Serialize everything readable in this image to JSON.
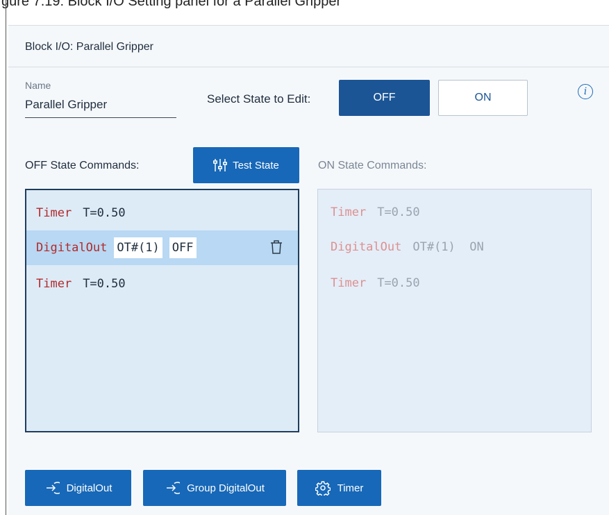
{
  "page": {
    "cutoff_title": "gure 7.19: Block I/O Setting panel for a Parallel Gripper"
  },
  "panel": {
    "title": "Block I/O: Parallel Gripper",
    "name_label": "Name",
    "name_value": "Parallel Gripper",
    "select_state_label": "Select State to Edit:",
    "state_off": "OFF",
    "state_on": "ON",
    "selected_state": "OFF",
    "info_icon": "i"
  },
  "off_state": {
    "label": "OFF State Commands:",
    "test_button": "Test State",
    "commands": [
      {
        "keyword": "Timer",
        "param": "T=0.50"
      },
      {
        "keyword": "DigitalOut",
        "output": "OT#(1)",
        "value": "OFF"
      },
      {
        "keyword": "Timer",
        "param": "T=0.50"
      }
    ]
  },
  "on_state": {
    "label": "ON State Commands:",
    "commands": [
      {
        "keyword": "Timer",
        "param": "T=0.50"
      },
      {
        "keyword": "DigitalOut",
        "param": "OT#(1)  ON"
      },
      {
        "keyword": "Timer",
        "param": "T=0.50"
      }
    ]
  },
  "add_buttons": {
    "digital_out": "DigitalOut",
    "group_digital_out": "Group DigitalOut",
    "timer": "Timer"
  },
  "icons": {
    "test_state": "sliders-icon",
    "digital_out": "arrow-in-circle-icon",
    "group_digital_out": "arrow-in-circle-icon",
    "timer": "gear-icon",
    "delete": "trash-icon",
    "info": "info-icon"
  },
  "colors": {
    "primary": "#1b5596",
    "button": "#1768b8",
    "keyword": "#b22a2a",
    "selected_row": "#b8d8f3"
  }
}
